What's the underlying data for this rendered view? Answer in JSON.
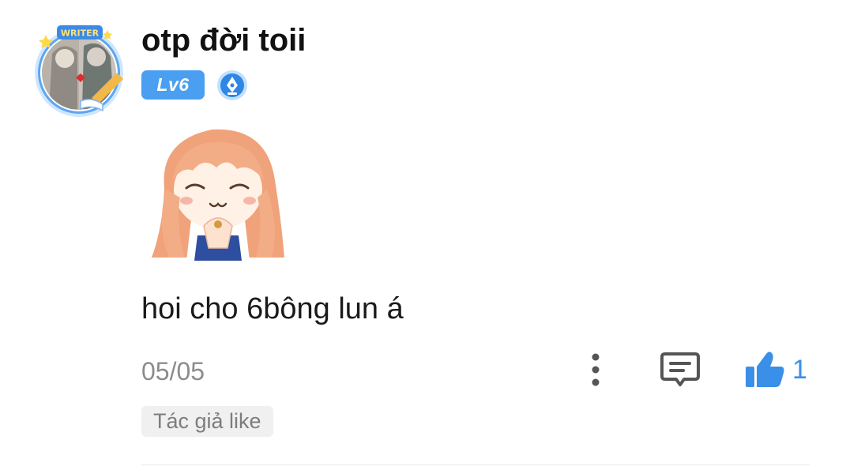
{
  "comment": {
    "username": "otp đời toii",
    "level": "Lv6",
    "avatar_frame_label": "WRITER",
    "text": "hoi cho 6bông lun á",
    "date": "05/05",
    "like_count": "1",
    "author_liked_tag": "Tác giả like"
  },
  "colors": {
    "level_badge": "#4a9ff0",
    "like_blue": "#3a8fe8",
    "text_primary": "#111111",
    "text_secondary": "#8c8c8c",
    "tag_background": "#f0f0f0"
  },
  "icons": {
    "more": "more-vertical-icon",
    "reply": "comment-icon",
    "like": "thumbs-up-icon",
    "writer_badge": "pen-nib-badge-icon"
  }
}
